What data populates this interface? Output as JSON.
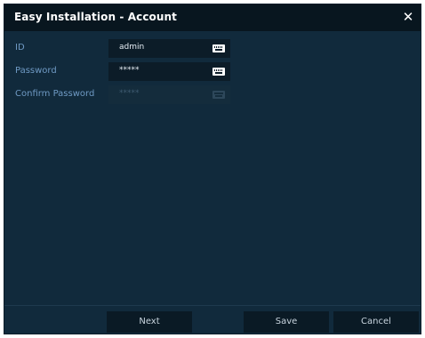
{
  "dialog": {
    "title": "Easy Installation - Account",
    "close_symbol": "✕"
  },
  "fields": [
    {
      "label": "ID",
      "value": "admin",
      "icon": "keyboard-icon",
      "disabled": false
    },
    {
      "label": "Password",
      "value": "*****",
      "icon": "keyboard-icon",
      "disabled": false
    },
    {
      "label": "Confirm Password",
      "value": "*****",
      "icon": "keyboard-icon",
      "disabled": true
    }
  ],
  "buttons": {
    "next": "Next",
    "save": "Save",
    "cancel": "Cancel"
  },
  "colors": {
    "dialog_background": "#112a3c",
    "titlebar": "#08161f",
    "label": "#6f9ac4",
    "field_background": "#0c1c28",
    "button_background": "#0a1a25"
  }
}
